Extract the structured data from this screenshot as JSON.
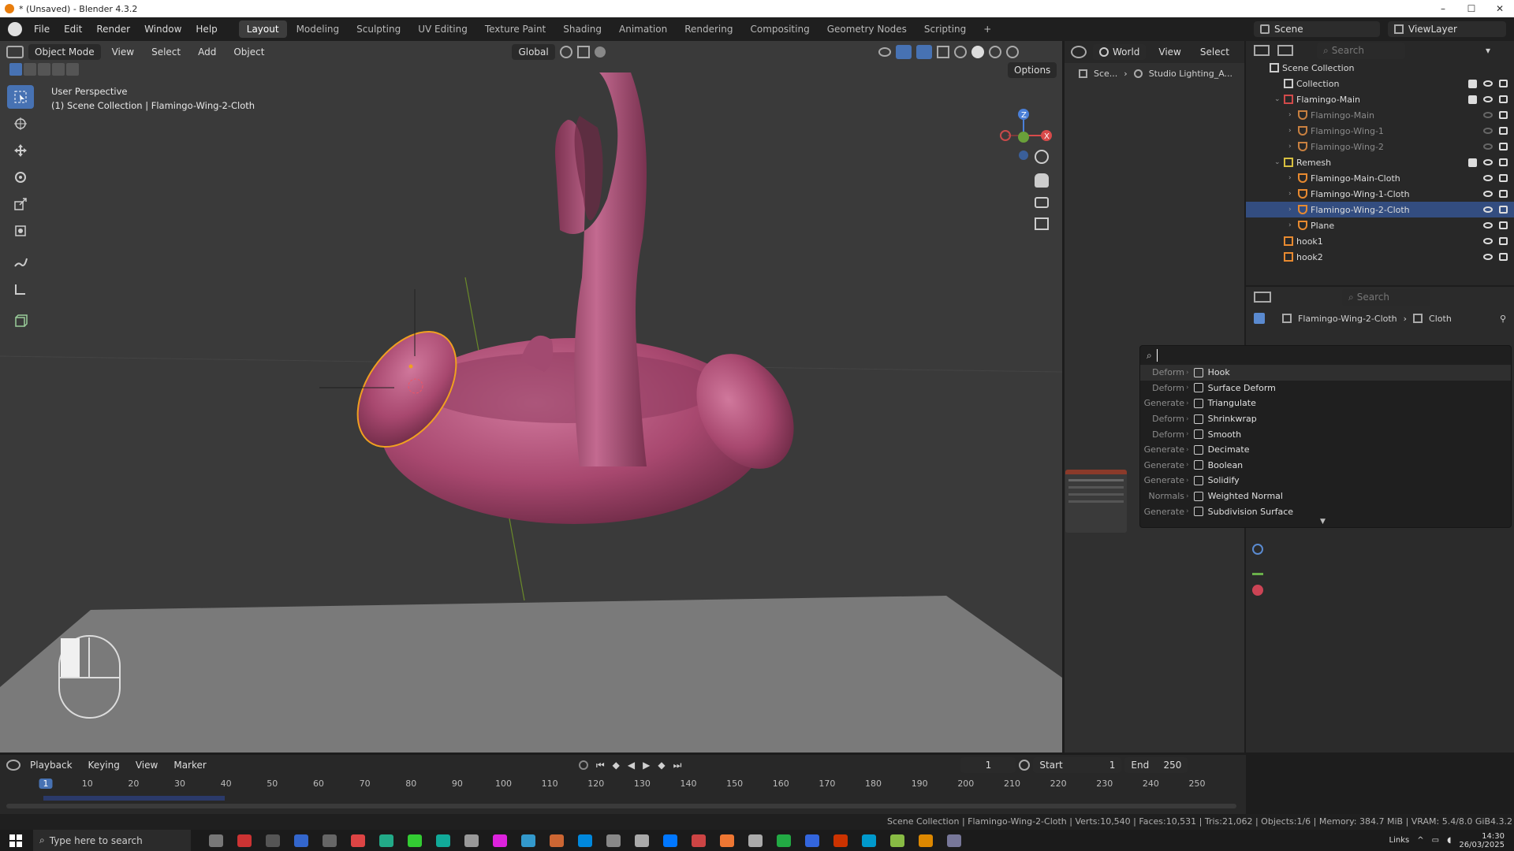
{
  "window": {
    "title": "* (Unsaved) - Blender 4.3.2",
    "controls": [
      "–",
      "☐",
      "✕"
    ]
  },
  "menu": [
    "File",
    "Edit",
    "Render",
    "Window",
    "Help"
  ],
  "workspaces": [
    "Layout",
    "Modeling",
    "Sculpting",
    "UV Editing",
    "Texture Paint",
    "Shading",
    "Animation",
    "Rendering",
    "Compositing",
    "Geometry Nodes",
    "Scripting"
  ],
  "active_workspace": "Layout",
  "scene": {
    "name": "Scene",
    "view_layer": "ViewLayer"
  },
  "viewport": {
    "mode": "Object Mode",
    "menus": [
      "View",
      "Select",
      "Add",
      "Object"
    ],
    "transform": "Global",
    "options": "Options",
    "overlay_title": "User Perspective",
    "overlay_sub": "(1) Scene Collection | Flamingo-Wing-2-Cloth",
    "object_color": "#b0507a",
    "selection_color": "#f0a020"
  },
  "world_panel": {
    "label": "World",
    "menus": [
      "View",
      "Select"
    ],
    "breadcrumb_scene": "Sce...",
    "breadcrumb_world": "Studio Lighting_A..."
  },
  "outliner": {
    "search_placeholder": "Search",
    "rows": [
      {
        "name": "Scene Collection",
        "indent": 0,
        "kind": "scene"
      },
      {
        "name": "Collection",
        "indent": 1,
        "kind": "collection"
      },
      {
        "name": "Flamingo-Main",
        "indent": 1,
        "kind": "collection-red"
      },
      {
        "name": "Flamingo-Main",
        "indent": 2,
        "kind": "mesh-dim"
      },
      {
        "name": "Flamingo-Wing-1",
        "indent": 2,
        "kind": "mesh-dim"
      },
      {
        "name": "Flamingo-Wing-2",
        "indent": 2,
        "kind": "mesh-dim"
      },
      {
        "name": "Remesh",
        "indent": 1,
        "kind": "collection-yellow"
      },
      {
        "name": "Flamingo-Main-Cloth",
        "indent": 2,
        "kind": "mesh"
      },
      {
        "name": "Flamingo-Wing-1-Cloth",
        "indent": 2,
        "kind": "mesh"
      },
      {
        "name": "Flamingo-Wing-2-Cloth",
        "indent": 2,
        "kind": "mesh-selected"
      },
      {
        "name": "Plane",
        "indent": 2,
        "kind": "mesh"
      },
      {
        "name": "hook1",
        "indent": 1,
        "kind": "empty"
      },
      {
        "name": "hook2",
        "indent": 1,
        "kind": "empty"
      }
    ]
  },
  "properties": {
    "search_placeholder": "Search",
    "object_name": "Flamingo-Wing-2-Cloth",
    "modifier_name": "Cloth"
  },
  "modifier_menu": {
    "items": [
      {
        "category": "Deform",
        "name": "Hook"
      },
      {
        "category": "Deform",
        "name": "Surface Deform"
      },
      {
        "category": "Generate",
        "name": "Triangulate"
      },
      {
        "category": "Deform",
        "name": "Shrinkwrap"
      },
      {
        "category": "Deform",
        "name": "Smooth"
      },
      {
        "category": "Generate",
        "name": "Decimate"
      },
      {
        "category": "Generate",
        "name": "Boolean"
      },
      {
        "category": "Generate",
        "name": "Solidify"
      },
      {
        "category": "Normals",
        "name": "Weighted Normal"
      },
      {
        "category": "Generate",
        "name": "Subdivision Surface"
      }
    ]
  },
  "timeline": {
    "menus": [
      "Playback",
      "Keying",
      "View",
      "Marker"
    ],
    "current_frame": "1",
    "start_label": "Start",
    "start": "1",
    "end_label": "End",
    "end": "250",
    "ticks": [
      "1",
      "10",
      "20",
      "30",
      "40",
      "50",
      "60",
      "70",
      "80",
      "90",
      "100",
      "110",
      "120",
      "130",
      "140",
      "150",
      "160",
      "170",
      "180",
      "190",
      "200",
      "210",
      "220",
      "230",
      "240",
      "250"
    ]
  },
  "statusbar": {
    "text": "Scene Collection | Flamingo-Wing-2-Cloth | Verts:10,540 | Faces:10,531 | Tris:21,062 | Objects:1/6 | Memory: 384.7 MiB | VRAM: 5.4/8.0 GiB",
    "version": "4.3.2"
  },
  "taskbar": {
    "search_placeholder": "Type here to search",
    "links": "Links",
    "time": "14:30",
    "date": "26/03/2025"
  }
}
